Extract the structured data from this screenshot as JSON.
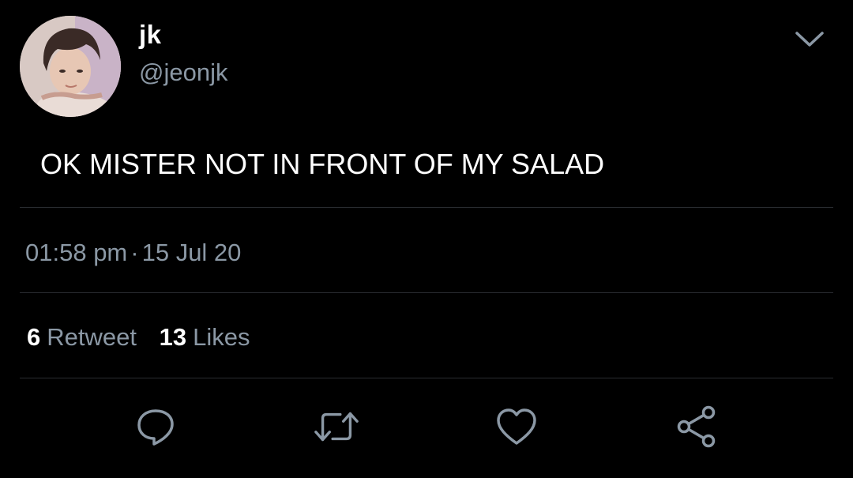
{
  "author": {
    "display_name": "jk",
    "handle": "@jeonjk",
    "avatar_icon": "profile-photo"
  },
  "header": {
    "menu_icon": "chevron-down-icon"
  },
  "tweet": {
    "text": "OK MISTER NOT IN FRONT OF MY SALAD",
    "time": "01:58 pm",
    "separator": "·",
    "date": "15 Jul 20"
  },
  "stats": {
    "retweets_count": "6",
    "retweets_label": "Retweet",
    "likes_count": "13",
    "likes_label": "Likes"
  },
  "actions": [
    {
      "name": "reply",
      "icon": "reply-icon"
    },
    {
      "name": "retweet",
      "icon": "retweet-icon"
    },
    {
      "name": "like",
      "icon": "heart-icon"
    },
    {
      "name": "share",
      "icon": "share-icon"
    }
  ],
  "colors": {
    "background": "#000000",
    "primary_text": "#ffffff",
    "secondary_text": "#8b98a5",
    "divider": "#2a2d31"
  }
}
